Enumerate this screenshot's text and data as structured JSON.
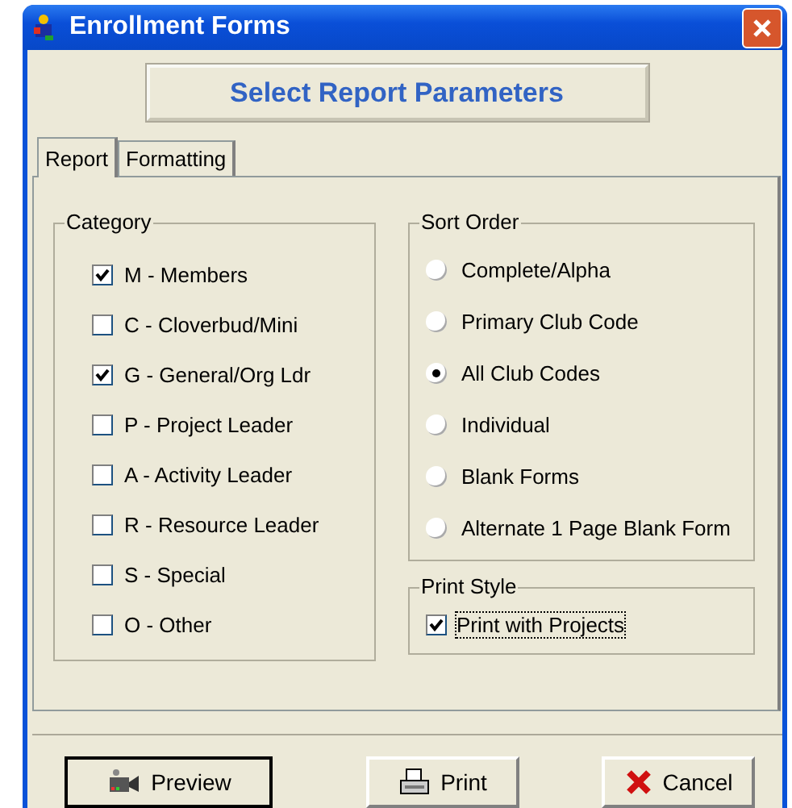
{
  "window": {
    "title": "Enrollment Forms"
  },
  "header": "Select Report Parameters",
  "tabs": [
    {
      "label": "Report",
      "selected": true
    },
    {
      "label": "Formatting",
      "selected": false
    }
  ],
  "category": {
    "title": "Category",
    "items": [
      {
        "label": "M - Members",
        "checked": true
      },
      {
        "label": "C - Cloverbud/Mini",
        "checked": false
      },
      {
        "label": "G - General/Org Ldr",
        "checked": true
      },
      {
        "label": "P - Project Leader",
        "checked": false
      },
      {
        "label": "A - Activity Leader",
        "checked": false
      },
      {
        "label": "R - Resource Leader",
        "checked": false
      },
      {
        "label": "S - Special",
        "checked": false
      },
      {
        "label": "O - Other",
        "checked": false
      }
    ]
  },
  "sort_order": {
    "title": "Sort Order",
    "options": [
      {
        "label": "Complete/Alpha",
        "selected": false
      },
      {
        "label": "Primary Club Code",
        "selected": false
      },
      {
        "label": "All Club Codes",
        "selected": true
      },
      {
        "label": "Individual",
        "selected": false
      },
      {
        "label": "Blank Forms",
        "selected": false
      },
      {
        "label": "Alternate 1 Page Blank Form",
        "selected": false
      }
    ]
  },
  "print_style": {
    "title": "Print Style",
    "items": [
      {
        "label": "Print with Projects",
        "checked": true
      }
    ]
  },
  "buttons": [
    {
      "label": "Preview",
      "kind": "preview"
    },
    {
      "label": "Print",
      "kind": "print"
    },
    {
      "label": "Cancel",
      "kind": "cancel"
    }
  ]
}
